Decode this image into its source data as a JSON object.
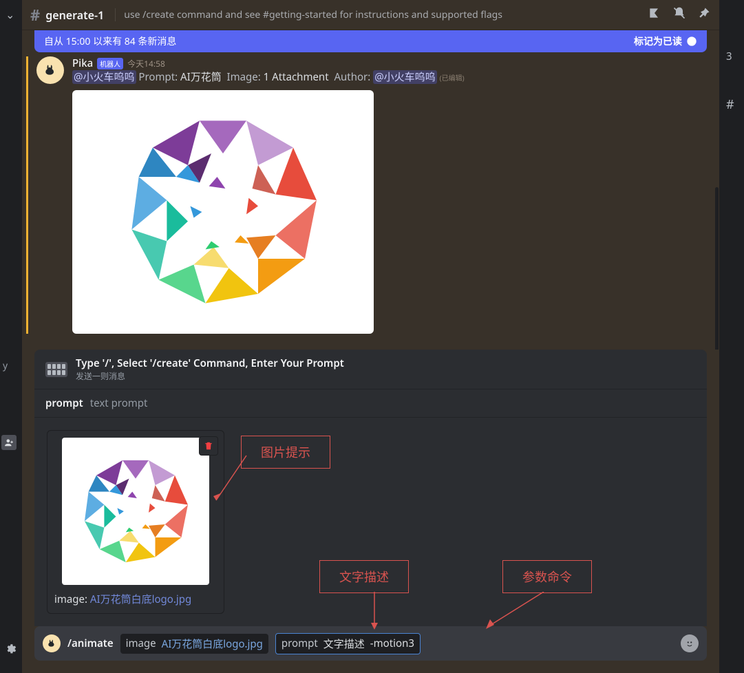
{
  "header": {
    "channel_name": "generate-1",
    "topic": "use /create command and see #getting-started for instructions and supported flags"
  },
  "new_messages_bar": {
    "text": "自从 15:00 以来有 84 条新消息",
    "mark_read": "标记为已读"
  },
  "message": {
    "author": "Pika",
    "bot_tag": "机器人",
    "timestamp": "今天14:58",
    "mention": "@小火车呜呜",
    "prompt_label": "Prompt:",
    "prompt_value": "AI万花筒",
    "image_label": "Image:",
    "image_value": "1 Attachment",
    "author_label": "Author:",
    "author_mention": "@小火车呜呜",
    "edited": "(已编辑)"
  },
  "command_popup": {
    "title": "Type '/', Select '/create' Command, Enter Your Prompt",
    "subtitle": "发送一则消息",
    "option_name": "prompt",
    "option_desc": "text prompt"
  },
  "upload": {
    "image_prefix": "image: ",
    "filename": "AI万花筒白底logo.jpg"
  },
  "annotations": {
    "image_hint": "图片提示",
    "text_desc": "文字描述",
    "param_cmd": "参数命令"
  },
  "input": {
    "command": "/animate",
    "param1_name": "image",
    "param1_value": "AI万花筒白底logo.jpg",
    "param2_name": "prompt",
    "param2_text": "文字描述",
    "param2_flag": "-motion3"
  },
  "right": {
    "count": "3",
    "hash": "#"
  },
  "left": {
    "letter": "y"
  }
}
